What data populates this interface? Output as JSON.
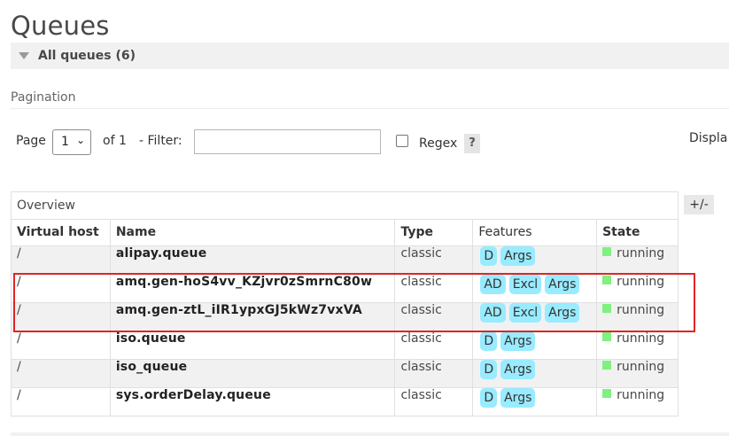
{
  "page": {
    "title": "Queues",
    "section_label": "All queues (6)",
    "pagination_label": "Pagination"
  },
  "pagination": {
    "page_label": "Page",
    "page_value": "1",
    "of_label": "of 1",
    "filter_label": "- Filter:",
    "filter_value": "",
    "regex_label": "Regex",
    "help_label": "?",
    "display_label": "Displa"
  },
  "table": {
    "group_label": "Overview",
    "toggle_label": "+/-",
    "headers": {
      "vhost": "Virtual host",
      "name": "Name",
      "type": "Type",
      "features": "Features",
      "state": "State"
    },
    "rows": [
      {
        "vhost": "/",
        "name": "alipay.queue",
        "type": "classic",
        "features": [
          "D",
          "Args"
        ],
        "state": "running"
      },
      {
        "vhost": "/",
        "name": "amq.gen-hoS4vv_KZjvr0zSmrnC80w",
        "type": "classic",
        "features": [
          "AD",
          "Excl",
          "Args"
        ],
        "state": "running"
      },
      {
        "vhost": "/",
        "name": "amq.gen-ztL_iIR1ypxGJ5kWz7vxVA",
        "type": "classic",
        "features": [
          "AD",
          "Excl",
          "Args"
        ],
        "state": "running"
      },
      {
        "vhost": "/",
        "name": "iso.queue",
        "type": "classic",
        "features": [
          "D",
          "Args"
        ],
        "state": "running"
      },
      {
        "vhost": "/",
        "name": "iso_queue",
        "type": "classic",
        "features": [
          "D",
          "Args"
        ],
        "state": "running"
      }
    ],
    "last_row": {
      "vhost": "/",
      "name": "sys.orderDelay.queue",
      "type": "classic",
      "features": [
        "D",
        "Args"
      ],
      "state": "running"
    }
  },
  "colors": {
    "feature_tag": "#99ebff",
    "state_running": "#80f080",
    "highlight_box": "#e02424"
  },
  "icons": {
    "section_toggle": "triangle-down-icon",
    "select_chevron": "chevron-down-icon"
  }
}
